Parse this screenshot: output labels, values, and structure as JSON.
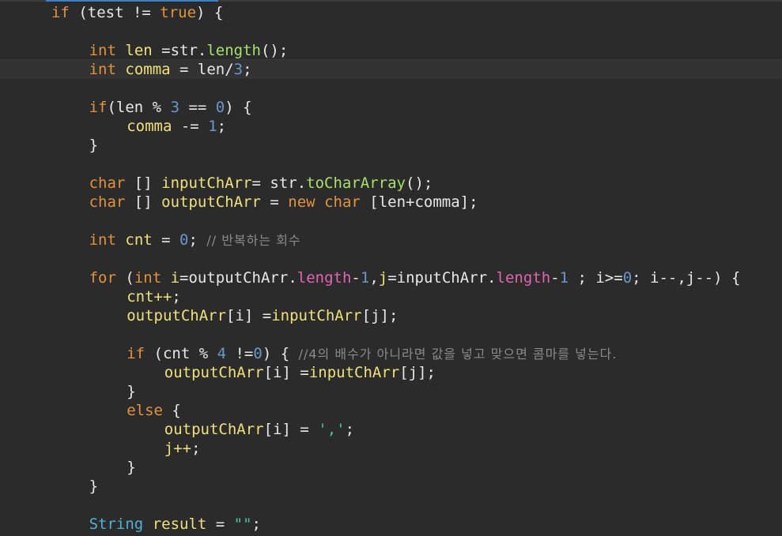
{
  "colors": {
    "background": "#2b2b2b",
    "keyword": "#e3933c",
    "identifier": "#f0e07a",
    "method": "#a8e06a",
    "field": "#e265b2",
    "number": "#6a97c9",
    "string": "#3fc7a9",
    "comment": "#8a8a8a",
    "type": "#4fb0d9",
    "text": "#e8e8e8"
  },
  "editor": {
    "current_line_index": 3,
    "lines": [
      {
        "indent": 1,
        "tokens": [
          {
            "k": "kw",
            "t": "if"
          },
          {
            "k": "tx",
            "t": " (test != "
          },
          {
            "k": "kw",
            "t": "true"
          },
          {
            "k": "tx",
            "t": ") {"
          }
        ]
      },
      {
        "indent": 0,
        "tokens": []
      },
      {
        "indent": 2,
        "tokens": [
          {
            "k": "kw",
            "t": "int"
          },
          {
            "k": "tx",
            "t": " "
          },
          {
            "k": "id",
            "t": "len"
          },
          {
            "k": "tx",
            "t": " =str."
          },
          {
            "k": "fn",
            "t": "length"
          },
          {
            "k": "tx",
            "t": "();"
          }
        ]
      },
      {
        "indent": 2,
        "tokens": [
          {
            "k": "kw",
            "t": "int"
          },
          {
            "k": "tx",
            "t": " "
          },
          {
            "k": "id",
            "t": "comma"
          },
          {
            "k": "tx",
            "t": " = len/"
          },
          {
            "k": "num",
            "t": "3"
          },
          {
            "k": "tx",
            "t": ";"
          }
        ]
      },
      {
        "indent": 0,
        "tokens": []
      },
      {
        "indent": 2,
        "tokens": [
          {
            "k": "kw",
            "t": "if"
          },
          {
            "k": "tx",
            "t": "(len % "
          },
          {
            "k": "num",
            "t": "3"
          },
          {
            "k": "tx",
            "t": " == "
          },
          {
            "k": "num",
            "t": "0"
          },
          {
            "k": "tx",
            "t": ") {"
          }
        ]
      },
      {
        "indent": 3,
        "tokens": [
          {
            "k": "id",
            "t": "comma"
          },
          {
            "k": "tx",
            "t": " -= "
          },
          {
            "k": "num",
            "t": "1"
          },
          {
            "k": "tx",
            "t": ";"
          }
        ]
      },
      {
        "indent": 2,
        "tokens": [
          {
            "k": "tx",
            "t": "}"
          }
        ]
      },
      {
        "indent": 0,
        "tokens": []
      },
      {
        "indent": 2,
        "tokens": [
          {
            "k": "kw",
            "t": "char"
          },
          {
            "k": "tx",
            "t": " [] "
          },
          {
            "k": "id",
            "t": "inputChArr"
          },
          {
            "k": "tx",
            "t": "= str."
          },
          {
            "k": "fn",
            "t": "toCharArray"
          },
          {
            "k": "tx",
            "t": "();"
          }
        ]
      },
      {
        "indent": 2,
        "tokens": [
          {
            "k": "kw",
            "t": "char"
          },
          {
            "k": "tx",
            "t": " [] "
          },
          {
            "k": "id",
            "t": "outputChArr"
          },
          {
            "k": "tx",
            "t": " = "
          },
          {
            "k": "kw",
            "t": "new"
          },
          {
            "k": "tx",
            "t": " "
          },
          {
            "k": "kw",
            "t": "char"
          },
          {
            "k": "tx",
            "t": " [len+comma];"
          }
        ]
      },
      {
        "indent": 0,
        "tokens": []
      },
      {
        "indent": 2,
        "tokens": [
          {
            "k": "kw",
            "t": "int"
          },
          {
            "k": "tx",
            "t": " "
          },
          {
            "k": "id",
            "t": "cnt"
          },
          {
            "k": "tx",
            "t": " = "
          },
          {
            "k": "num",
            "t": "0"
          },
          {
            "k": "tx",
            "t": "; "
          },
          {
            "k": "cmt",
            "t": "// 반복하는 회수"
          }
        ]
      },
      {
        "indent": 0,
        "tokens": []
      },
      {
        "indent": 2,
        "tokens": [
          {
            "k": "kw",
            "t": "for"
          },
          {
            "k": "tx",
            "t": " ("
          },
          {
            "k": "kw",
            "t": "int"
          },
          {
            "k": "tx",
            "t": " "
          },
          {
            "k": "id",
            "t": "i"
          },
          {
            "k": "tx",
            "t": "=outputChArr."
          },
          {
            "k": "mem",
            "t": "length"
          },
          {
            "k": "tx",
            "t": "-"
          },
          {
            "k": "num",
            "t": "1"
          },
          {
            "k": "tx",
            "t": ","
          },
          {
            "k": "id",
            "t": "j"
          },
          {
            "k": "tx",
            "t": "=inputChArr."
          },
          {
            "k": "mem",
            "t": "length"
          },
          {
            "k": "tx",
            "t": "-"
          },
          {
            "k": "num",
            "t": "1"
          },
          {
            "k": "tx",
            "t": " ; i>="
          },
          {
            "k": "num",
            "t": "0"
          },
          {
            "k": "tx",
            "t": "; i--,j--) {"
          }
        ]
      },
      {
        "indent": 3,
        "tokens": [
          {
            "k": "id",
            "t": "cnt++"
          },
          {
            "k": "tx",
            "t": ";"
          }
        ]
      },
      {
        "indent": 3,
        "tokens": [
          {
            "k": "id",
            "t": "outputChArr"
          },
          {
            "k": "tx",
            "t": "[i] ="
          },
          {
            "k": "id",
            "t": "inputChArr"
          },
          {
            "k": "tx",
            "t": "[j];"
          }
        ]
      },
      {
        "indent": 0,
        "tokens": []
      },
      {
        "indent": 3,
        "tokens": [
          {
            "k": "kw",
            "t": "if"
          },
          {
            "k": "tx",
            "t": " (cnt % "
          },
          {
            "k": "num",
            "t": "4"
          },
          {
            "k": "tx",
            "t": " !="
          },
          {
            "k": "num",
            "t": "0"
          },
          {
            "k": "tx",
            "t": ") { "
          },
          {
            "k": "cmt",
            "t": "//4의 배수가 아니라면 값을 넣고 맞으면 콤마를 넣는다."
          }
        ]
      },
      {
        "indent": 4,
        "tokens": [
          {
            "k": "id",
            "t": "outputChArr"
          },
          {
            "k": "tx",
            "t": "[i] ="
          },
          {
            "k": "id",
            "t": "inputChArr"
          },
          {
            "k": "tx",
            "t": "[j];"
          }
        ]
      },
      {
        "indent": 3,
        "tokens": [
          {
            "k": "tx",
            "t": "}"
          }
        ]
      },
      {
        "indent": 3,
        "tokens": [
          {
            "k": "kw",
            "t": "else"
          },
          {
            "k": "tx",
            "t": " {"
          }
        ]
      },
      {
        "indent": 4,
        "tokens": [
          {
            "k": "id",
            "t": "outputChArr"
          },
          {
            "k": "tx",
            "t": "[i] = "
          },
          {
            "k": "str",
            "t": "','"
          },
          {
            "k": "tx",
            "t": ";"
          }
        ]
      },
      {
        "indent": 4,
        "tokens": [
          {
            "k": "id",
            "t": "j++"
          },
          {
            "k": "tx",
            "t": ";"
          }
        ]
      },
      {
        "indent": 3,
        "tokens": [
          {
            "k": "tx",
            "t": "}"
          }
        ]
      },
      {
        "indent": 2,
        "tokens": [
          {
            "k": "tx",
            "t": "}"
          }
        ]
      },
      {
        "indent": 0,
        "tokens": []
      },
      {
        "indent": 2,
        "tokens": [
          {
            "k": "typ",
            "t": "String"
          },
          {
            "k": "tx",
            "t": " "
          },
          {
            "k": "id",
            "t": "result"
          },
          {
            "k": "tx",
            "t": " = "
          },
          {
            "k": "str",
            "t": "\"\""
          },
          {
            "k": "tx",
            "t": ";"
          }
        ]
      }
    ]
  }
}
